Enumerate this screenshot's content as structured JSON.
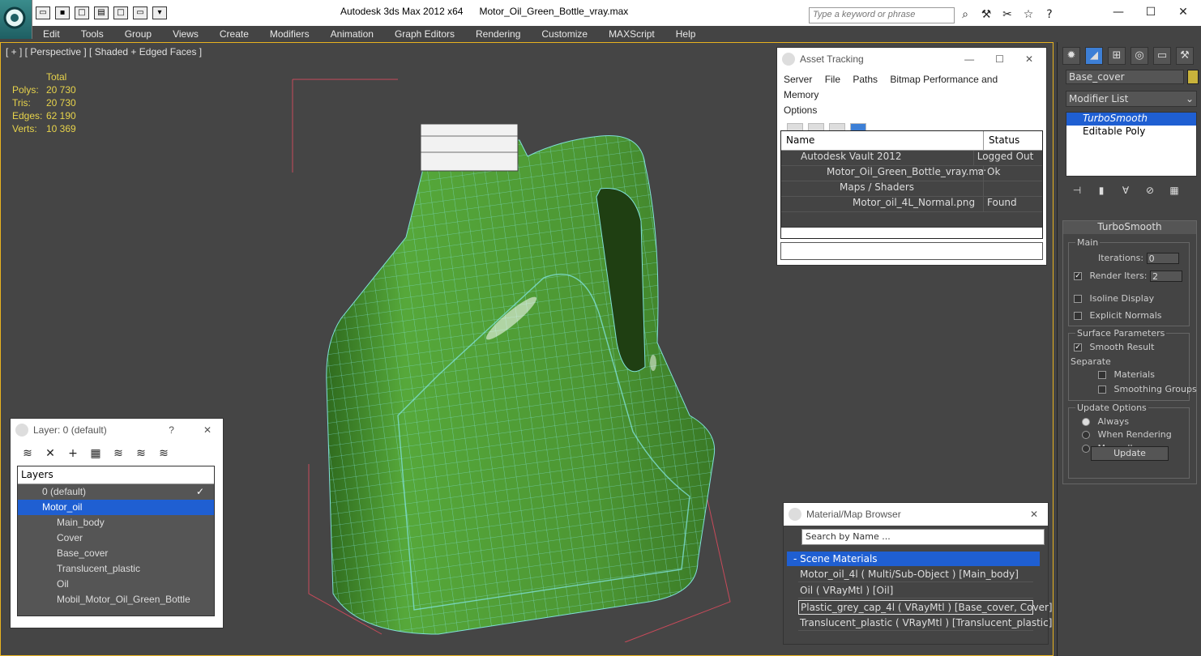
{
  "titlebar": {
    "app": "Autodesk 3ds Max  2012 x64",
    "file": "Motor_Oil_Green_Bottle_vray.max",
    "search_placeholder": "Type a keyword or phrase",
    "win_minimize": "—",
    "win_restore": "☐",
    "win_close": "✕"
  },
  "menus": [
    "Edit",
    "Tools",
    "Group",
    "Views",
    "Create",
    "Modifiers",
    "Animation",
    "Graph Editors",
    "Rendering",
    "Customize",
    "MAXScript",
    "Help"
  ],
  "viewport": {
    "label": "[ + ] [ Perspective ] [ Shaded + Edged Faces ]",
    "stats_header": "Total",
    "stats": [
      {
        "label": "Polys:",
        "value": "20 730"
      },
      {
        "label": "Tris:",
        "value": "20 730"
      },
      {
        "label": "Edges:",
        "value": "62 190"
      },
      {
        "label": "Verts:",
        "value": "10 369"
      }
    ]
  },
  "asset_tracking": {
    "title": "Asset Tracking",
    "menu": [
      "Server",
      "File",
      "Paths",
      "Bitmap Performance and Memory",
      "Options"
    ],
    "col_name": "Name",
    "col_status": "Status",
    "rows": [
      {
        "name": "Autodesk Vault 2012",
        "status": "Logged Out ..."
      },
      {
        "name": "Motor_Oil_Green_Bottle_vray.max",
        "status": "Ok"
      },
      {
        "name": "Maps / Shaders",
        "status": ""
      },
      {
        "name": "Motor_oil_4L_Normal.png",
        "status": "Found"
      }
    ]
  },
  "layer_dialog": {
    "title": "Layer: 0 (default)",
    "help": "?",
    "close": "✕",
    "header": "Layers",
    "rows": [
      {
        "name": "0 (default)",
        "level": 1
      },
      {
        "name": "Motor_oil",
        "level": 1
      },
      {
        "name": "Main_body",
        "level": 2
      },
      {
        "name": "Cover",
        "level": 2
      },
      {
        "name": "Base_cover",
        "level": 2
      },
      {
        "name": "Translucent_plastic",
        "level": 2
      },
      {
        "name": "Oil",
        "level": 2
      },
      {
        "name": "Mobil_Motor_Oil_Green_Bottle",
        "level": 2
      }
    ]
  },
  "material_browser": {
    "title": "Material/Map Browser",
    "search_placeholder": "Search by Name ...",
    "category": "- Scene Materials",
    "items": [
      "Motor_oil_4l  ( Multi/Sub-Object )  [Main_body]",
      "Oil  ( VRayMtl )  [Oil]",
      "Plastic_grey_cap_4l  ( VRayMtl )  [Base_cover, Cover]",
      "Translucent_plastic  ( VRayMtl )  [Translucent_plastic]"
    ]
  },
  "command_panel": {
    "object_name": "Base_cover",
    "object_color": "#c9b33b",
    "modifier_list": "Modifier List",
    "stack": [
      "TurboSmooth",
      "Editable Poly"
    ],
    "rollout_title": "TurboSmooth",
    "main_group": "Main",
    "iterations_label": "Iterations:",
    "iterations_value": "0",
    "render_iters_label": "Render Iters:",
    "render_iters_value": "2",
    "isoline": "Isoline Display",
    "explicit": "Explicit Normals",
    "surface_group": "Surface Parameters",
    "smooth_result": "Smooth Result",
    "separate": "Separate",
    "materials": "Materials",
    "smoothing_groups": "Smoothing Groups",
    "update_group": "Update Options",
    "always": "Always",
    "when_rendering": "When Rendering",
    "manually": "Manually",
    "update_btn": "Update"
  },
  "colors": {
    "viewport_border": "#e8b21f",
    "selection": "#1f5fd2",
    "bottle": "#4e9a33",
    "wire": "#7fe0d8"
  }
}
